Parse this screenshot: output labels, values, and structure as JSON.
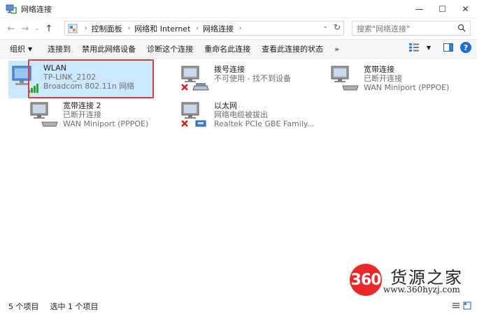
{
  "window": {
    "title": "网络连接",
    "minimize": "—",
    "maximize": "☐",
    "close": "✕"
  },
  "nav": {
    "back": "←",
    "forward": "→",
    "recent": "⌄",
    "up": "↑"
  },
  "address": {
    "crumbs": [
      "控制面板",
      "网络和 Internet",
      "网络连接"
    ],
    "search_placeholder": "搜索\"网络连接\""
  },
  "toolbar": {
    "organize": "组织",
    "connect_to": "连接到",
    "disable": "禁用此网络设备",
    "diagnose": "诊断这个连接",
    "rename": "重命名此连接",
    "view_status": "查看此连接的状态",
    "more": "»"
  },
  "connections": [
    {
      "name": "WLAN",
      "line1": "TP-LINK_2102",
      "line2": "Broadcom 802.11n 网络",
      "type": "wifi",
      "status": "connected",
      "selected": true
    },
    {
      "name": "拨号连接",
      "line1": "不可使用 - 找不到设备",
      "line2": "",
      "type": "dialup",
      "status": "error",
      "selected": false
    },
    {
      "name": "宽带连接",
      "line1": "已断开连接",
      "line2": "WAN Miniport (PPPOE)",
      "type": "broadband",
      "status": "disconnected",
      "selected": false
    },
    {
      "name": "宽带连接 2",
      "line1": "已断开连接",
      "line2": "WAN Miniport (PPPOE)",
      "type": "broadband",
      "status": "disconnected",
      "selected": false
    },
    {
      "name": "以太网",
      "line1": "网络电缆被拔出",
      "line2": "Realtek PCIe GBE Family...",
      "type": "ethernet",
      "status": "error",
      "selected": false
    }
  ],
  "status": {
    "count": "5 个项目",
    "selected": "选中 1 个项目"
  },
  "watermark": {
    "badge": "360",
    "title": "货源之家",
    "url": "www.360hyzj.com"
  },
  "colors": {
    "selection": "#cce8ff",
    "highlight": "#d93a3a",
    "help": "#1a6fd1",
    "watermark": "#e8282b"
  }
}
